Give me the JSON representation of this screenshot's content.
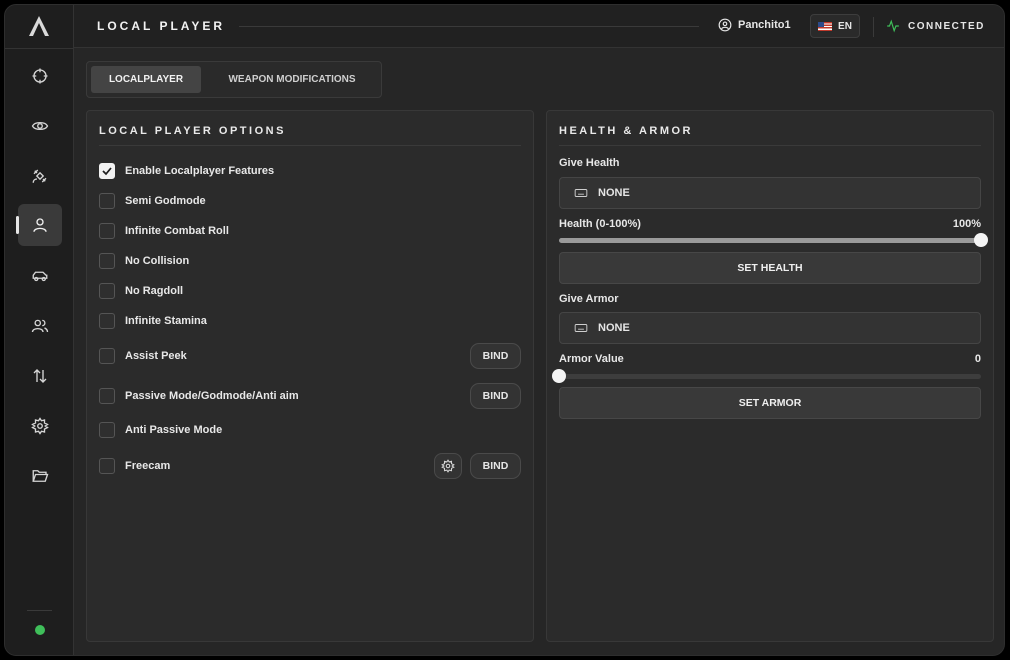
{
  "header": {
    "title": "LOCAL PLAYER",
    "username": "Panchito1",
    "language": "EN",
    "connection_status": "CONNECTED"
  },
  "sidebar": {
    "items": [
      {
        "icon": "crosshair-icon",
        "active": false
      },
      {
        "icon": "eye-icon",
        "active": false
      },
      {
        "icon": "satellite-icon",
        "active": false
      },
      {
        "icon": "user-icon",
        "active": true
      },
      {
        "icon": "car-icon",
        "active": false
      },
      {
        "icon": "users-icon",
        "active": false
      },
      {
        "icon": "arrows-up-down-icon",
        "active": false
      },
      {
        "icon": "gear-icon",
        "active": false
      },
      {
        "icon": "folder-icon",
        "active": false
      }
    ],
    "status_color": "#3fbf5a"
  },
  "tabs": [
    {
      "label": "LOCALPLAYER",
      "active": true
    },
    {
      "label": "WEAPON MODIFICATIONS",
      "active": false
    }
  ],
  "local_player": {
    "title": "LOCAL PLAYER OPTIONS",
    "options": [
      {
        "label": "Enable Localplayer Features",
        "checked": true
      },
      {
        "label": "Semi Godmode",
        "checked": false
      },
      {
        "label": "Infinite Combat Roll",
        "checked": false
      },
      {
        "label": "No Collision",
        "checked": false
      },
      {
        "label": "No Ragdoll",
        "checked": false
      },
      {
        "label": "Infinite Stamina",
        "checked": false
      },
      {
        "label": "Assist Peek",
        "checked": false,
        "bind": "BIND"
      },
      {
        "label": "Passive Mode/Godmode/Anti aim",
        "checked": false,
        "bind": "BIND"
      },
      {
        "label": "Anti Passive Mode",
        "checked": false
      },
      {
        "label": "Freecam",
        "checked": false,
        "bind": "BIND",
        "settings": true
      }
    ]
  },
  "health_armor": {
    "title": "HEALTH & ARMOR",
    "give_health_label": "Give Health",
    "give_health_key": "NONE",
    "health_label": "Health (0-100%)",
    "health_value": "100%",
    "health_fraction": 1.0,
    "set_health_label": "SET HEALTH",
    "give_armor_label": "Give Armor",
    "give_armor_key": "NONE",
    "armor_label": "Armor Value",
    "armor_value": "0",
    "armor_fraction": 0.0,
    "set_armor_label": "SET ARMOR"
  }
}
